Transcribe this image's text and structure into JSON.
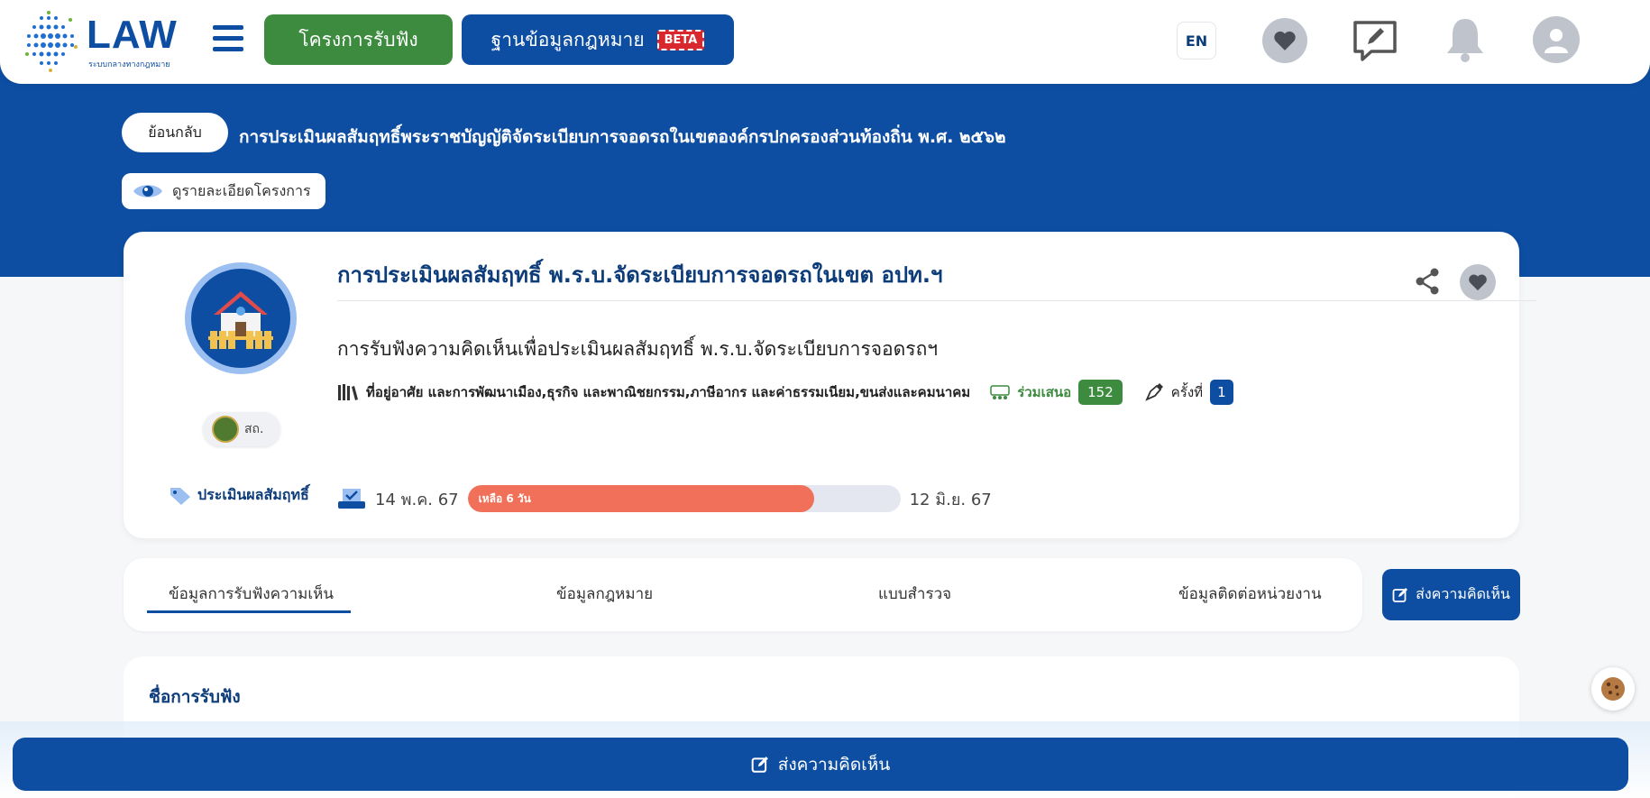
{
  "header": {
    "logo_text": "LAW",
    "logo_subtitle": "ระบบกลางทางกฎหมาย",
    "nav_primary": "โครงการรับฟัง",
    "nav_secondary": "ฐานข้อมูลกฎหมาย",
    "beta_badge": "BETA",
    "language": "EN",
    "icons": [
      "menu-icon",
      "heart-icon",
      "comment-edit-icon",
      "bell-icon",
      "user-icon"
    ]
  },
  "hero": {
    "back_label": "ย้อนกลับ",
    "title": "การประเมินผลสัมฤทธิ์พระราชบัญญัติจัดระเบียบการจอดรถในเขตองค์กรปกครองส่วนท้องถิ่น พ.ศ. ๒๕๖๒",
    "detail_label": "ดูรายละเอียดโครงการ"
  },
  "project": {
    "title": "การประเมินผลสัมฤทธิ์ พ.ร.บ.จัดระเบียบการจอดรถในเขต อปท.ฯ",
    "subtitle": "การรับฟังความคิดเห็นเพื่อประเมินผลสัมฤทธิ์ พ.ร.บ.จัดระเบียบการจอดรถฯ",
    "categories": "ที่อยู่อาศัย และการพัฒนาเมือง,ธุรกิจ และพาณิชยกรรม,ภาษีอากร และค่าธรรมเนียม,ขนส่งและคมนาคม",
    "participants_label": "ร่วมเสนอ",
    "participants_count": "152",
    "round_label": "ครั้งที่",
    "round_value": "1",
    "agency": "สถ.",
    "type_tag": "ประเมินผลสัมฤทธิ์",
    "start_date": "14 พ.ค. 67",
    "end_date": "12 มิ.ย. 67",
    "remaining_label": "เหลือ 6 วัน",
    "progress_fraction": 0.8
  },
  "tabs": [
    {
      "label": "ข้อมูลการรับฟังความเห็น",
      "active": true
    },
    {
      "label": "ข้อมูลกฎหมาย",
      "active": false
    },
    {
      "label": "แบบสำรวจ",
      "active": false
    },
    {
      "label": "ข้อมูลติดต่อหน่วยงาน",
      "active": false
    }
  ],
  "send_comment_label": "ส่งความคิดเห็น",
  "info": {
    "heading": "ชื่อการรับฟัง"
  },
  "colors": {
    "brand_blue": "#0d4ea3",
    "green": "#3c8b3f",
    "progress": "#f07059"
  }
}
